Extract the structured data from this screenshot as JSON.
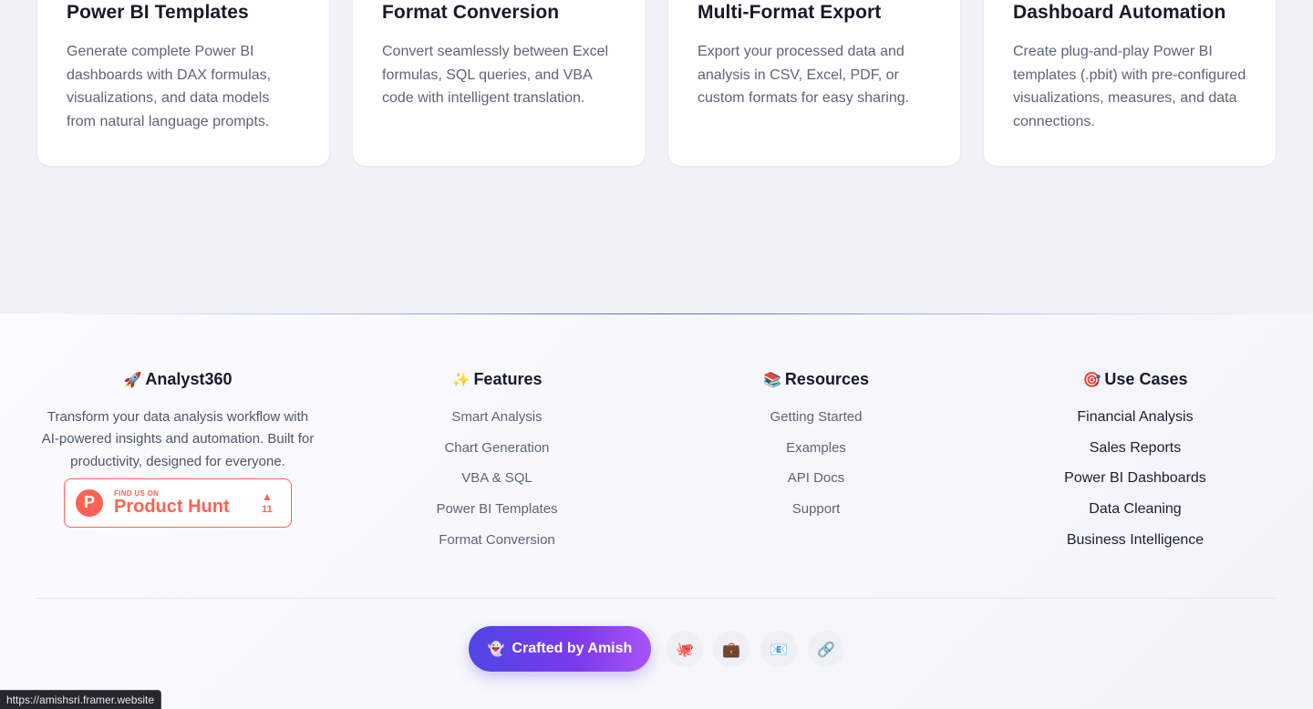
{
  "feature_cards": [
    {
      "title": "Power BI Templates",
      "desc": "Generate complete Power BI dashboards with DAX formulas, visualizations, and data models from natural language prompts."
    },
    {
      "title": "Format Conversion",
      "desc": "Convert seamlessly between Excel formulas, SQL queries, and VBA code with intelligent translation."
    },
    {
      "title": "Multi-Format Export",
      "desc": "Export your processed data and analysis in CSV, Excel, PDF, or custom formats for easy sharing."
    },
    {
      "title": "Dashboard Automation",
      "desc": "Create plug-and-play Power BI templates (.pbit) with pre-configured visualizations, measures, and data connections."
    }
  ],
  "footer": {
    "brand": {
      "emoji": "🚀",
      "title": "Analyst360",
      "description": "Transform your data analysis workflow with AI-powered insights and automation. Built for productivity, designed for everyone.",
      "product_hunt": {
        "small": "FIND US ON",
        "big": "Product Hunt",
        "logo": "P",
        "arrow": "▲",
        "votes": "11"
      }
    },
    "features": {
      "emoji": "✨",
      "title": "Features",
      "links": [
        "Smart Analysis",
        "Chart Generation",
        "VBA & SQL",
        "Power BI Templates",
        "Format Conversion"
      ]
    },
    "resources": {
      "emoji": "📚",
      "title": "Resources",
      "links": [
        "Getting Started",
        "Examples",
        "API Docs",
        "Support"
      ]
    },
    "use_cases": {
      "emoji": "🎯",
      "title": "Use Cases",
      "links": [
        "Financial Analysis",
        "Sales Reports",
        "Power BI Dashboards",
        "Data Cleaning",
        "Business Intelligence"
      ]
    },
    "crafted": {
      "emoji": "👻",
      "label": "Crafted by Amish"
    },
    "social_icons": [
      "🐙",
      "💼",
      "📧",
      "🔗"
    ]
  },
  "status_bar": {
    "url": "https://amishsri.framer.website"
  },
  "colors": {
    "accent": "#6366f1",
    "product_hunt": "#ff6154",
    "background": "#f1f2f8"
  }
}
